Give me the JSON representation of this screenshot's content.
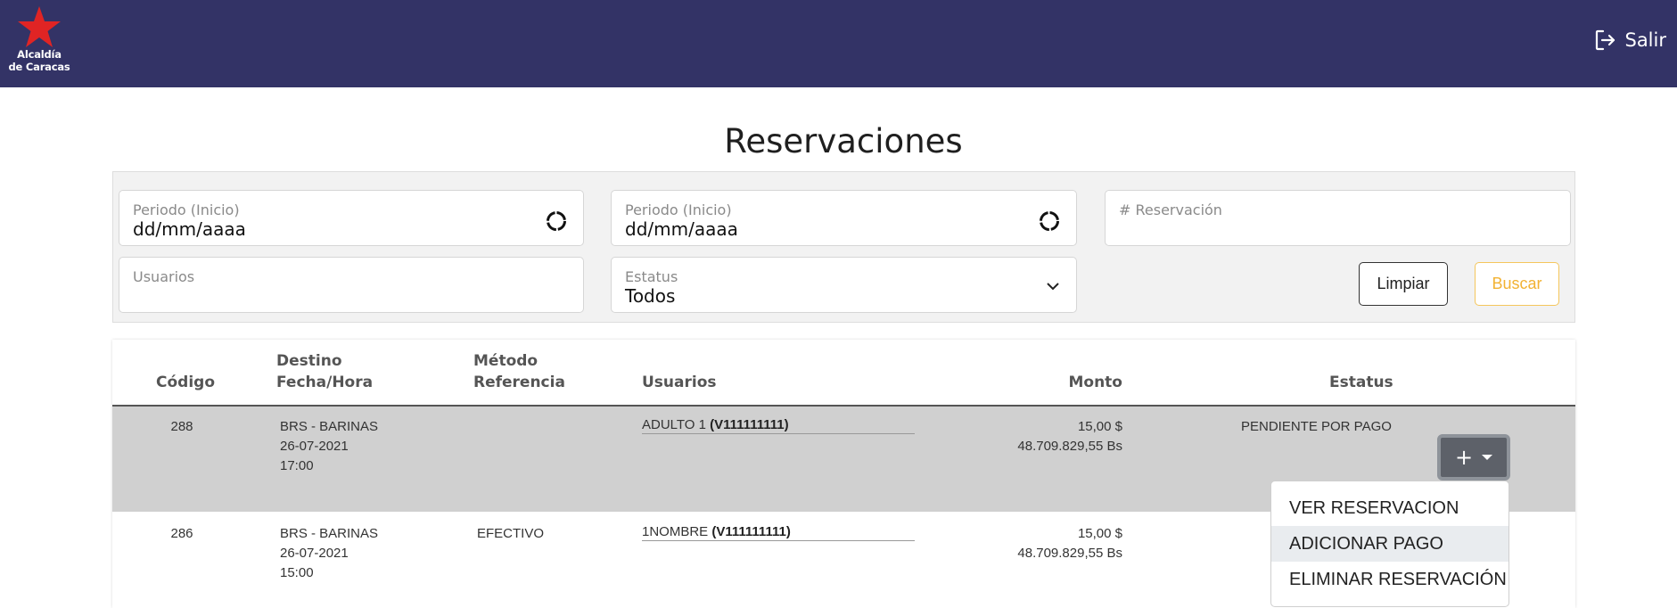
{
  "header": {
    "logo_line1": "Alcaldía",
    "logo_line2": "de Caracas",
    "logout_label": "Salir"
  },
  "page": {
    "title": "Reservaciones"
  },
  "filters": {
    "start_label": "Periodo (Inicio)",
    "start_value": "dd/mm/aaaa",
    "end_label": "Periodo (Inicio)",
    "end_value": "dd/mm/aaaa",
    "reservation_label": "# Reservación",
    "users_label": "Usuarios",
    "status_label": "Estatus",
    "status_value": "Todos",
    "clear_label": "Limpiar",
    "search_label": "Buscar"
  },
  "table": {
    "headers": {
      "code": "Código",
      "dest_line1": "Destino",
      "dest_line2": "Fecha/Hora",
      "method_line1": "Método",
      "method_line2": "Referencia",
      "users": "Usuarios",
      "amount": "Monto",
      "status": "Estatus"
    },
    "rows": [
      {
        "code": "288",
        "destination": "BRS - BARINAS",
        "date": "26-07-2021",
        "time": "17:00",
        "method": "",
        "user_name": "ADULTO 1",
        "user_id": "(V111111111)",
        "amount_usd": "15,00 $",
        "amount_bs": "48.709.829,55 Bs",
        "status": "PENDIENTE POR PAGO"
      },
      {
        "code": "286",
        "destination": "BRS - BARINAS",
        "date": "26-07-2021",
        "time": "15:00",
        "method": "EFECTIVO",
        "user_name": "1NOMBRE",
        "user_id": "(V111111111)",
        "amount_usd": "15,00 $",
        "amount_bs": "48.709.829,55 Bs",
        "status": ""
      }
    ]
  },
  "action_menu": {
    "plus_label": "+",
    "items": [
      "VER RESERVACION",
      "ADICIONAR PAGO",
      "ELIMINAR RESERVACIÓN"
    ]
  },
  "colors": {
    "topbar": "#333366",
    "logo_star": "#e02424",
    "search_accent": "#f2b233",
    "row_highlight": "#d0d0d0"
  }
}
